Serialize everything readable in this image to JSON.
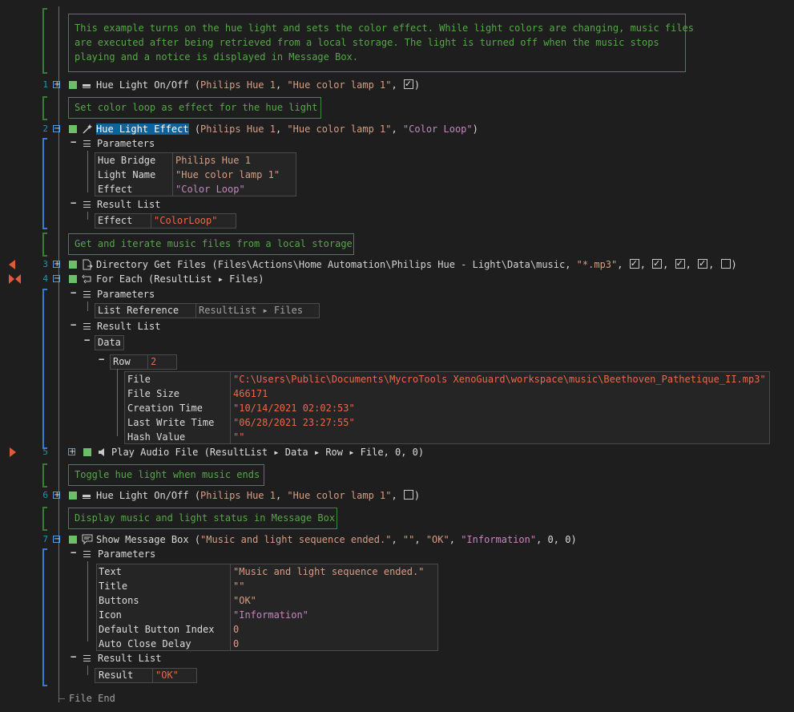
{
  "comments": {
    "intro": "This example turns on the hue light and sets the color effect. While light colors are changing, music files\nare executed after being retrieved from a local storage. The light is turned off when the music stops\nplaying and a notice is displayed in Message Box.",
    "c2": "Set color loop as effect for the hue light",
    "c3": "Get and iterate music files from a local storage",
    "c6": "Toggle hue light when music ends",
    "c7": "Display music and light status in Message Box"
  },
  "line_numbers": [
    "1",
    "2",
    "3",
    "4",
    "5",
    "6",
    "7"
  ],
  "step1": {
    "name": "Hue Light On/Off",
    "open": " (",
    "bridge": "Philips Hue 1",
    "comma1": ", ",
    "lamp": "\"Hue color lamp 1\"",
    "comma2": ", ",
    "close": ")"
  },
  "step2": {
    "name": "Hue Light Effect",
    "open": " (",
    "bridge": "Philips Hue 1",
    "comma1": ", ",
    "lamp": "\"Hue color lamp 1\"",
    "comma2": ", ",
    "effect": "\"Color Loop\"",
    "close": ")"
  },
  "step2_params": {
    "header": "Parameters",
    "rows": [
      {
        "label": "Hue Bridge",
        "value": "Philips Hue 1"
      },
      {
        "label": "Light Name",
        "value": "\"Hue color lamp 1\""
      },
      {
        "label": "Effect",
        "value": "\"Color Loop\""
      }
    ]
  },
  "step2_result": {
    "header": "Result List",
    "label": "Effect",
    "value": "\"ColorLoop\""
  },
  "step3": {
    "name": "Directory Get Files",
    "open": " (",
    "path": "Files\\Actions\\Home Automation\\Philips Hue - Light\\Data\\music",
    "comma": ", ",
    "pattern": "\"*.mp3\"",
    "close": ")"
  },
  "step4": {
    "name": "For Each",
    "args": " (ResultList ▸ Files)"
  },
  "step4_params": {
    "header": "Parameters",
    "label": "List Reference",
    "value": "ResultList ▸ Files"
  },
  "step4_result": {
    "header": "Result List",
    "data": "Data",
    "row_label": "Row",
    "row_value": "2",
    "fields": [
      {
        "label": "File",
        "value": "\"C:\\Users\\Public\\Documents\\MycroTools XenoGuard\\workspace\\music\\Beethoven_Pathetique_II.mp3\""
      },
      {
        "label": "File Size",
        "value": "466171"
      },
      {
        "label": "Creation Time",
        "value": "\"10/14/2021 02:02:53\""
      },
      {
        "label": "Last Write Time",
        "value": "\"06/28/2021 23:27:55\""
      },
      {
        "label": "Hash Value",
        "value": "\"\""
      }
    ]
  },
  "step5": {
    "name": "Play Audio File",
    "args": " (ResultList ▸ Data ▸ Row ▸ File, 0, 0)"
  },
  "step6": {
    "name": "Hue Light On/Off",
    "open": " (",
    "bridge": "Philips Hue 1",
    "comma1": ", ",
    "lamp": "\"Hue color lamp 1\"",
    "comma2": ", ",
    "close": ")"
  },
  "step7": {
    "name": "Show Message Box",
    "open": " (",
    "text": "\"Music and light sequence ended.\"",
    "c1": ", ",
    "title": "\"\"",
    "c2": ", ",
    "buttons": "\"OK\"",
    "c3": ", ",
    "icon": "\"Information\"",
    "rest": ", 0, 0)"
  },
  "step7_params": {
    "header": "Parameters",
    "rows": [
      {
        "label": "Text",
        "value": "\"Music and light sequence ended.\""
      },
      {
        "label": "Title",
        "value": "\"\""
      },
      {
        "label": "Buttons",
        "value": "\"OK\""
      },
      {
        "label": "Icon",
        "value": "\"Information\""
      },
      {
        "label": "Default Button Index",
        "value": "0"
      },
      {
        "label": "Auto Close Delay",
        "value": "0"
      }
    ]
  },
  "step7_result": {
    "header": "Result List",
    "label": "Result",
    "value": "\"OK\""
  },
  "file_end": "File End",
  "colors": {
    "background": "#1e1e1e",
    "comment": "#57a64a",
    "line_number": "#2b91af",
    "string": "#d69d85",
    "effect": "#c586c0",
    "status_ok": "#6abf69",
    "breakpoint": "#e05a3a",
    "selection": "#0e639c"
  }
}
